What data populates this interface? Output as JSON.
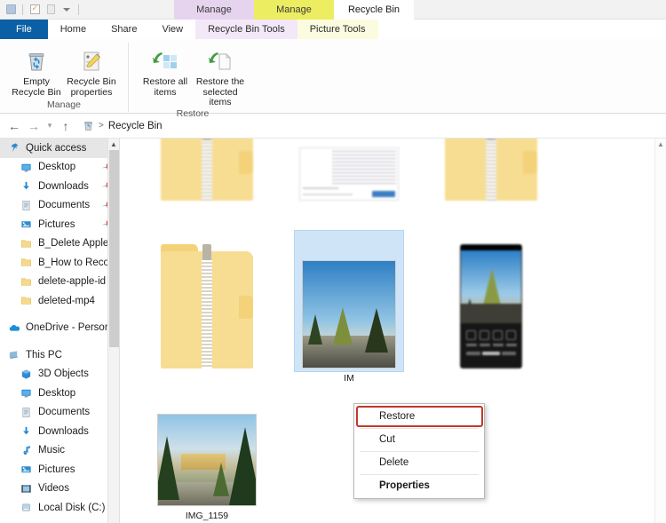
{
  "window": {
    "title": "Recycle Bin"
  },
  "quick_access_toolbar": {
    "items": [
      {
        "name": "recycle-bin-icon",
        "label": "Recycle Bin"
      },
      {
        "name": "properties-icon",
        "label": "Properties"
      },
      {
        "name": "new-folder-icon",
        "label": "New folder"
      },
      {
        "name": "customize-dropdown",
        "label": "Customize Quick Access Toolbar"
      }
    ]
  },
  "contextual_tab_groups": [
    {
      "title": "Manage",
      "tab": "Recycle Bin Tools",
      "color": "#e6d4ef",
      "tab_color": "#f2e8f7"
    },
    {
      "title": "Manage",
      "tab": "Picture Tools",
      "color": "#eded62",
      "tab_color": "#fbfbe0"
    }
  ],
  "ribbon": {
    "tabs": [
      {
        "label": "File",
        "active": false,
        "style": "file"
      },
      {
        "label": "Home",
        "active": false,
        "style": "normal"
      },
      {
        "label": "Share",
        "active": false,
        "style": "normal"
      },
      {
        "label": "View",
        "active": false,
        "style": "normal"
      },
      {
        "label": "Recycle Bin Tools",
        "active": true,
        "style": "ctx-purple"
      },
      {
        "label": "Picture Tools",
        "active": false,
        "style": "ctx-yellow"
      }
    ],
    "groups": [
      {
        "label": "Manage",
        "buttons": [
          {
            "name": "empty-recycle-bin-button",
            "label": "Empty\nRecycle Bin",
            "icon": "recycle-bin-icon"
          },
          {
            "name": "recycle-bin-properties-button",
            "label": "Recycle Bin\nproperties",
            "icon": "properties-icon"
          }
        ]
      },
      {
        "label": "Restore",
        "buttons": [
          {
            "name": "restore-all-items-button",
            "label": "Restore\nall items",
            "icon": "restore-all-icon"
          },
          {
            "name": "restore-selected-items-button",
            "label": "Restore the\nselected items",
            "icon": "restore-selected-icon"
          }
        ]
      }
    ]
  },
  "address_bar": {
    "back_label": "Back",
    "forward_label": "Forward",
    "recent_label": "Recent locations",
    "up_label": "Up",
    "breadcrumb_icon": "recycle-bin-icon",
    "breadcrumb_separator": ">",
    "breadcrumb": "Recycle Bin"
  },
  "sidebar": {
    "items": [
      {
        "label": "Quick access",
        "icon": "pin-icon",
        "level": "root",
        "selected": true,
        "pinned": false
      },
      {
        "label": "Desktop",
        "icon": "desktop-icon",
        "level": "child",
        "selected": false,
        "pinned": true
      },
      {
        "label": "Downloads",
        "icon": "download-icon",
        "level": "child",
        "selected": false,
        "pinned": true
      },
      {
        "label": "Documents",
        "icon": "documents-icon",
        "level": "child",
        "selected": false,
        "pinned": true
      },
      {
        "label": "Pictures",
        "icon": "pictures-icon",
        "level": "child",
        "selected": false,
        "pinned": true
      },
      {
        "label": "B_Delete Apple I",
        "icon": "folder-icon",
        "level": "child",
        "selected": false,
        "pinned": false
      },
      {
        "label": "B_How to Recov",
        "icon": "folder-icon",
        "level": "child",
        "selected": false,
        "pinned": false
      },
      {
        "label": "delete-apple-id",
        "icon": "folder-icon",
        "level": "child",
        "selected": false,
        "pinned": false
      },
      {
        "label": "deleted-mp4",
        "icon": "folder-icon",
        "level": "child",
        "selected": false,
        "pinned": false
      },
      {
        "label": "GAP",
        "icon": "gap",
        "level": "gap",
        "selected": false,
        "pinned": false
      },
      {
        "label": "OneDrive - Person",
        "icon": "onedrive-icon",
        "level": "root",
        "selected": false,
        "pinned": false
      },
      {
        "label": "GAP",
        "icon": "gap",
        "level": "gap",
        "selected": false,
        "pinned": false
      },
      {
        "label": "This PC",
        "icon": "this-pc-icon",
        "level": "root",
        "selected": false,
        "pinned": false
      },
      {
        "label": "3D Objects",
        "icon": "3d-objects-icon",
        "level": "child",
        "selected": false,
        "pinned": false
      },
      {
        "label": "Desktop",
        "icon": "desktop-icon",
        "level": "child",
        "selected": false,
        "pinned": false
      },
      {
        "label": "Documents",
        "icon": "documents-icon",
        "level": "child",
        "selected": false,
        "pinned": false
      },
      {
        "label": "Downloads",
        "icon": "download-icon",
        "level": "child",
        "selected": false,
        "pinned": false
      },
      {
        "label": "Music",
        "icon": "music-icon",
        "level": "child",
        "selected": false,
        "pinned": false
      },
      {
        "label": "Pictures",
        "icon": "pictures-icon",
        "level": "child",
        "selected": false,
        "pinned": false
      },
      {
        "label": "Videos",
        "icon": "videos-icon",
        "level": "child",
        "selected": false,
        "pinned": false
      },
      {
        "label": "Local Disk (C:)",
        "icon": "disk-icon",
        "level": "child",
        "selected": false,
        "pinned": false
      }
    ]
  },
  "files": {
    "rows": [
      [
        {
          "name": "zip-folder-item",
          "caption": "",
          "thumb": "zip-folder-cropped",
          "selected": false,
          "blurred": true
        },
        {
          "name": "document-item",
          "caption": "",
          "thumb": "document",
          "selected": false,
          "blurred": true
        },
        {
          "name": "zip-folder-item-2",
          "caption": "",
          "thumb": "zip-folder-cropped",
          "selected": false,
          "blurred": true
        }
      ],
      [
        {
          "name": "zip-folder-item-3",
          "caption": "",
          "thumb": "zip-folder",
          "selected": false,
          "blurred": true
        },
        {
          "name": "image-item-selected",
          "caption": "IM",
          "thumb": "photo",
          "selected": true,
          "blurred": false
        },
        {
          "name": "phone-screenshot-item",
          "caption": "",
          "thumb": "phone",
          "selected": false,
          "blurred": true
        }
      ],
      [
        {
          "name": "image-item-img1159",
          "caption": "IMG_1159",
          "thumb": "landscape",
          "selected": false,
          "blurred": false
        }
      ]
    ]
  },
  "context_menu": {
    "items": [
      {
        "label": "Restore",
        "bold": false,
        "highlighted": true
      },
      {
        "label": "Cut",
        "bold": false,
        "highlighted": false
      },
      {
        "label": "Delete",
        "bold": false,
        "highlighted": false
      },
      {
        "label": "Properties",
        "bold": true,
        "highlighted": false
      }
    ],
    "highlight_color": "#c0392b"
  },
  "colors": {
    "file_tab": "#0b5fa5",
    "selection": "#cfe5f7",
    "contextual_purple": "#e6d4ef",
    "contextual_yellow": "#eded62",
    "highlight_red": "#c0392b"
  }
}
